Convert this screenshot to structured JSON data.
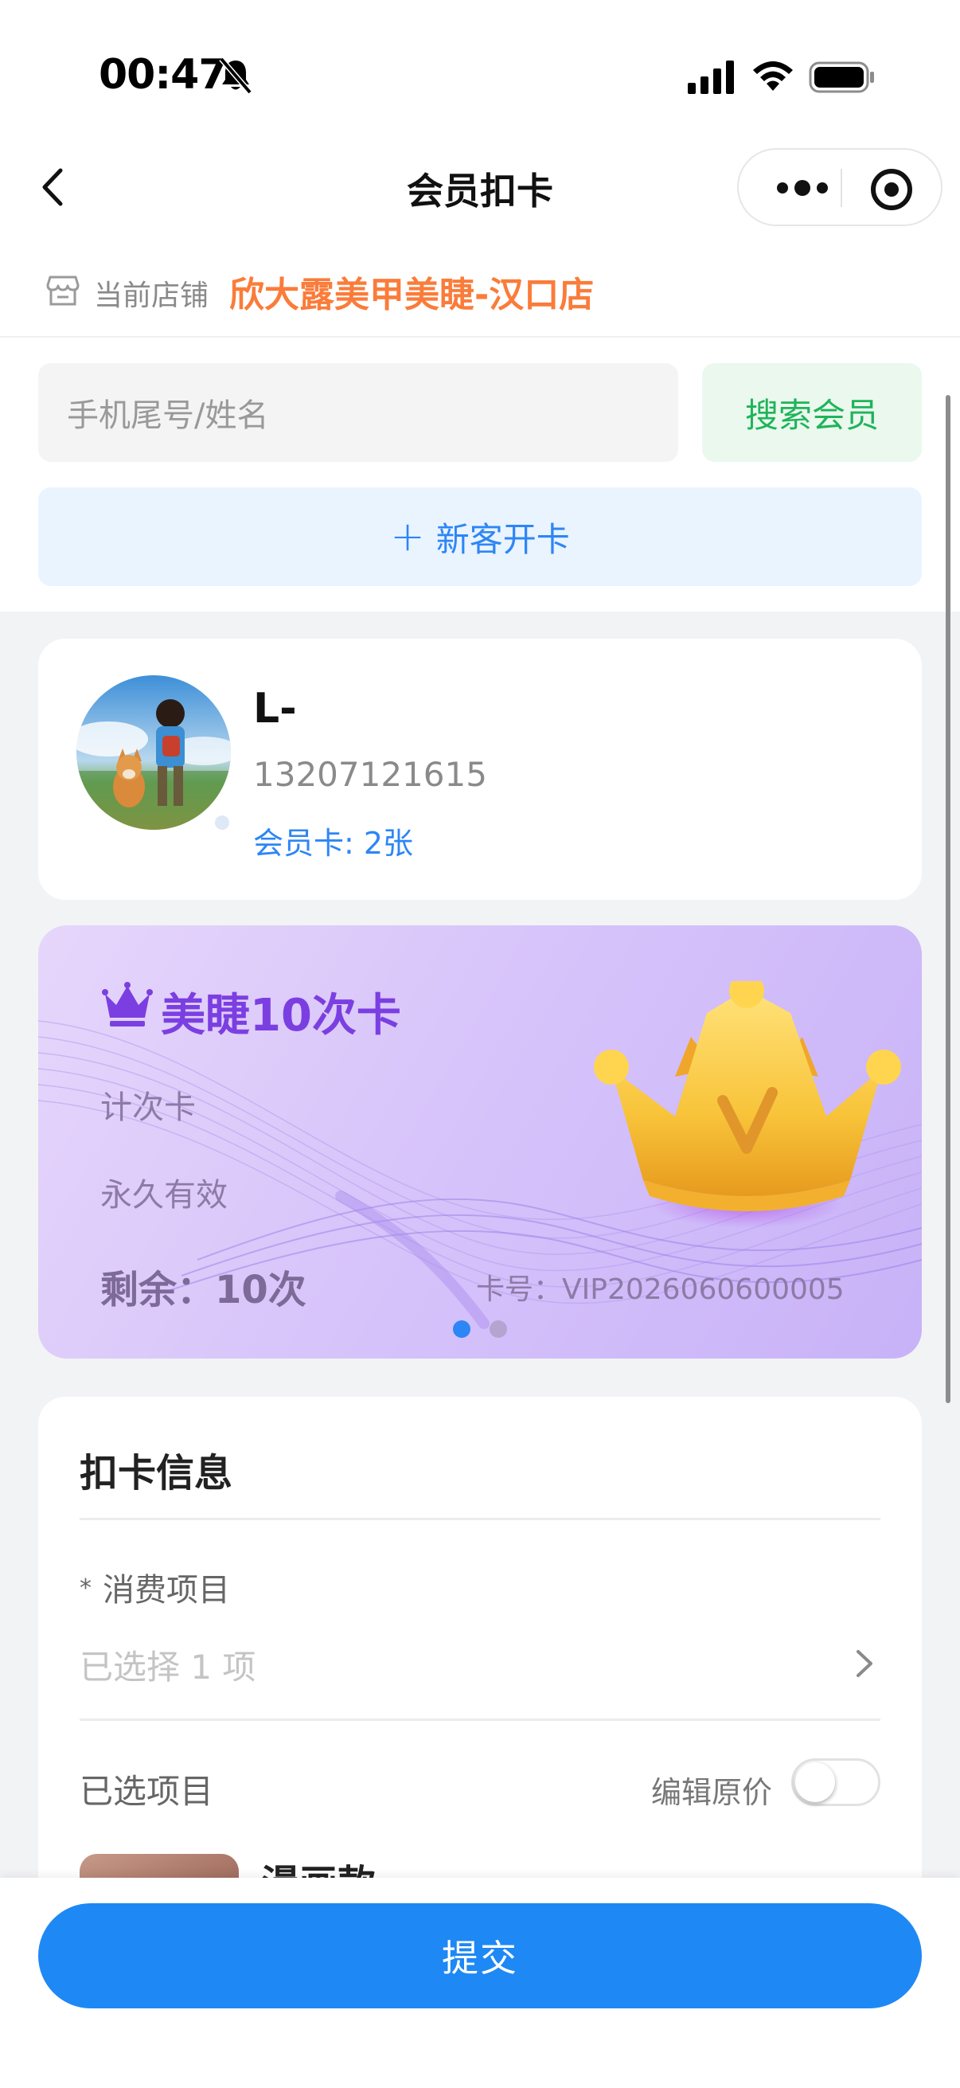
{
  "status_bar": {
    "time": "00:47",
    "icons": [
      "bell-slash-icon",
      "cellular-signal-icon",
      "wifi-icon",
      "battery-icon"
    ]
  },
  "nav": {
    "title": "会员扣卡",
    "back_icon": "chevron-left-icon",
    "more_icon": "more-dots-icon",
    "close_icon": "target-circle-icon"
  },
  "store": {
    "label": "当前店铺",
    "name": "欣大露美甲美睫-汉口店",
    "icon": "store-icon"
  },
  "search": {
    "placeholder": "手机尾号/姓名",
    "button": "搜索会员"
  },
  "new_card": {
    "plus": "+",
    "label": "新客开卡"
  },
  "member": {
    "name": "L-",
    "phone": "13207121615",
    "card_count": "会员卡: 2张"
  },
  "vip_card": {
    "title": "美睫10次卡",
    "type": "计次卡",
    "validity": "永久有效",
    "remaining": "剩余：10次",
    "card_no": "卡号：VIP2026060600005",
    "pager_total": 2,
    "pager_active": 0
  },
  "deduct": {
    "title": "扣卡信息",
    "required_mark": "*",
    "item_label": "消费项目",
    "item_value": "已选择 1 项",
    "selected_label": "已选项目",
    "edit_price_label": "编辑原价",
    "edit_price_on": false,
    "selected_items": [
      {
        "name": "漫画款"
      }
    ]
  },
  "submit": {
    "label": "提交"
  },
  "colors": {
    "primary": "#1E88F5",
    "orange": "#FA7C3A",
    "green": "#1FB45A",
    "purple": "#7B3FE1"
  }
}
